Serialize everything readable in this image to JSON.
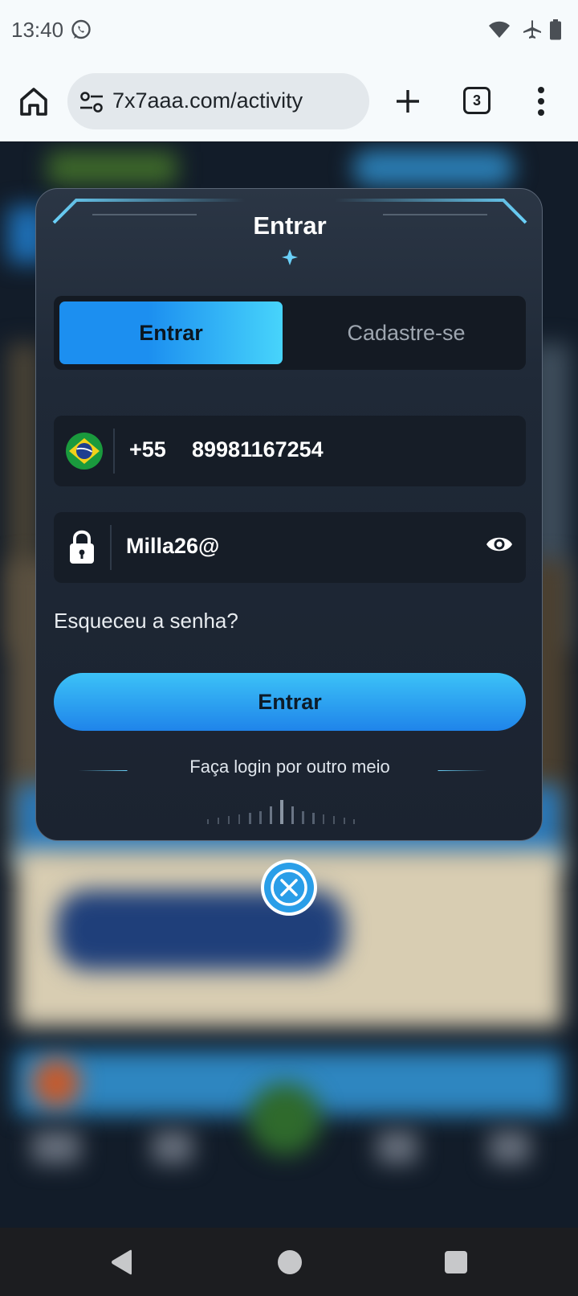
{
  "status_bar": {
    "time": "13:40",
    "icons": [
      "whatsapp-icon",
      "wifi-icon",
      "airplane-icon",
      "battery-icon"
    ]
  },
  "browser": {
    "url": "7x7aaa.com/activity",
    "tab_count": "3",
    "icons": [
      "home-icon",
      "tune-icon",
      "plus-icon",
      "tabs-icon",
      "menu-icon"
    ]
  },
  "login_dialog": {
    "title": "Entrar",
    "tabs": [
      {
        "label": "Entrar",
        "active": true
      },
      {
        "label": "Cadastre-se",
        "active": false
      }
    ],
    "phone": {
      "country_flag": "brazil-flag-icon",
      "dial_code": "+55",
      "number": "89981167254"
    },
    "password": {
      "value": "Milla26@",
      "icons": [
        "lock-icon",
        "eye-icon"
      ]
    },
    "forgot_password_label": "Esqueceu a senha?",
    "submit_label": "Entrar",
    "alt_login_label": "Faça login por outro meio"
  },
  "close_icon": "close-icon",
  "nav_bar": {
    "icons": [
      "back-icon",
      "home-icon",
      "recents-icon"
    ]
  },
  "colors": {
    "accent": "#1f84ea",
    "accent_light": "#47d4fb",
    "dialog_bg": "#1f2937",
    "field_bg": "#161d27"
  }
}
